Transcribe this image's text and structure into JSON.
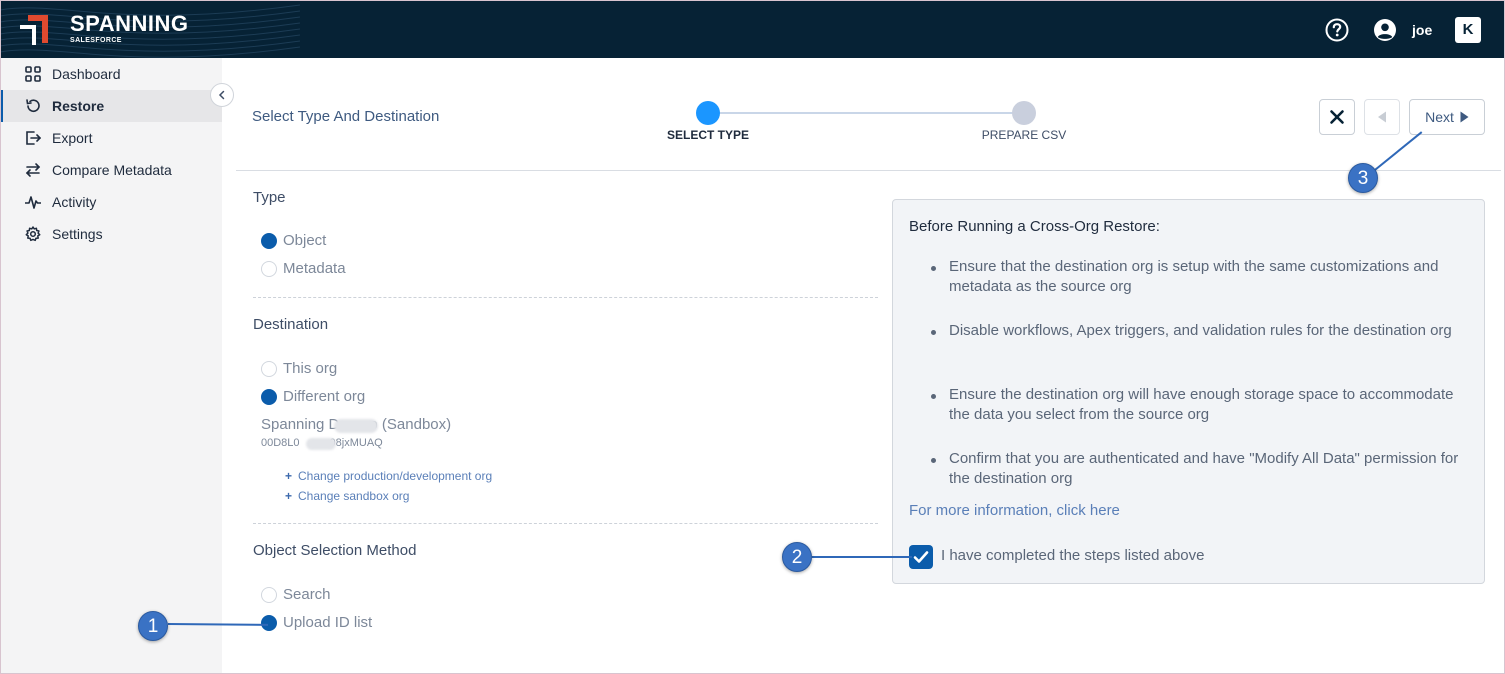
{
  "header": {
    "brand": "SPANNING",
    "brand_sub": "SALESFORCE",
    "user_name": "joe",
    "icons": [
      "help-icon",
      "user-icon",
      "kaseya-icon"
    ],
    "kaseya_glyph": "K"
  },
  "sidebar": {
    "items": [
      {
        "label": "Dashboard",
        "icon": "grid-icon"
      },
      {
        "label": "Restore",
        "icon": "restore-icon",
        "active": true
      },
      {
        "label": "Export",
        "icon": "export-icon"
      },
      {
        "label": "Compare Metadata",
        "icon": "compare-arrows-icon"
      },
      {
        "label": "Activity",
        "icon": "pulse-icon"
      },
      {
        "label": "Settings",
        "icon": "gear-icon"
      }
    ]
  },
  "main": {
    "title": "Select Type And Destination",
    "steps": [
      {
        "label": "SELECT TYPE",
        "state": "current"
      },
      {
        "label": "PREPARE CSV",
        "state": "pending"
      }
    ],
    "actions": {
      "next_label": "Next"
    },
    "type_section": {
      "title": "Type",
      "options": [
        {
          "label": "Object",
          "selected": true
        },
        {
          "label": "Metadata",
          "selected": false
        }
      ]
    },
    "destination_section": {
      "title": "Destination",
      "options": [
        {
          "label": "This org",
          "selected": false
        },
        {
          "label": "Different org",
          "selected": true
        }
      ],
      "org_name_prefix": "Spanning D",
      "org_name_suffix": "o (Sandbox)",
      "org_id_prefix": "00D8L0",
      "org_id_suffix": "08jxMUAQ",
      "links": [
        "Change production/development org",
        "Change sandbox org"
      ]
    },
    "selection_section": {
      "title": "Object Selection Method",
      "options": [
        {
          "label": "Search",
          "selected": false
        },
        {
          "label": "Upload ID list",
          "selected": true
        }
      ]
    }
  },
  "info_panel": {
    "title": "Before Running a Cross-Org Restore:",
    "items": [
      "Ensure that the destination org is setup with the same customizations and metadata as the source org",
      "Disable workflows, Apex triggers, and validation rules for the destination org",
      "Ensure the destination org will have enough storage space to accommodate the data you select from the source org",
      "Confirm that you are authenticated and have \"Modify All Data\" permission for the destination org"
    ],
    "link": "For more information, click here",
    "checkbox_label": "I have completed the steps listed above",
    "checkbox_checked": true
  },
  "callouts": [
    "1",
    "2",
    "3"
  ],
  "colors": {
    "header_bg": "#062235",
    "accent": "#0b5cab",
    "step_active": "#1b96ff",
    "callout": "#3a72c4"
  }
}
